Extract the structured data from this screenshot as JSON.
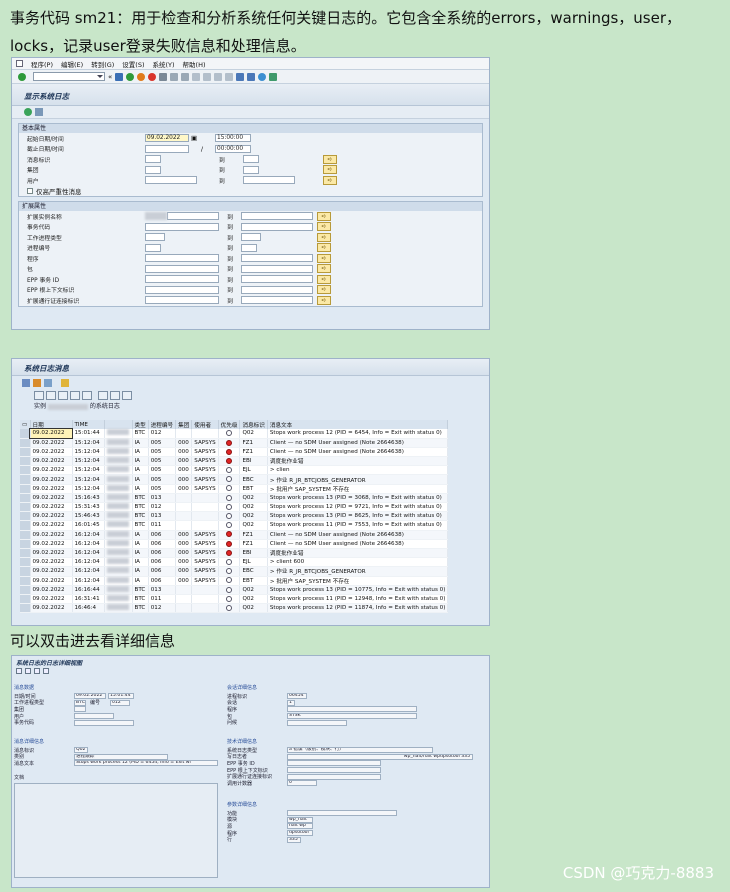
{
  "intro_text": "事务代码 sm21：用于检查和分析系统任何关键日志的。它包含全系统的errors，warnings，user，locks，记录user登录失败信息和处理信息。",
  "caption_text": "可以双击进去看详细信息",
  "watermark": "CSDN @巧克力-8883",
  "screen1": {
    "menu": [
      "程序(P)",
      "编辑(E)",
      "转到(G)",
      "设置(S)",
      "系统(Y)",
      "帮助(H)"
    ],
    "title": "显示系统日志",
    "group_basic": "基本属性",
    "group_extended": "扩展属性",
    "fields_basic": [
      {
        "label": "起始日期/时间",
        "value1": "09.02.2022",
        "value2": "15:00:00"
      },
      {
        "label": "截止日期/时间",
        "value1": "",
        "value2": "00:00:00"
      },
      {
        "label": "消息标识",
        "value1": "",
        "value2": ""
      },
      {
        "label": "集团",
        "value1": "",
        "value2": ""
      },
      {
        "label": "用户",
        "value1": "",
        "value2": ""
      }
    ],
    "only_severe": "仅高严重性消息",
    "to_label": "到",
    "fields_extended": [
      "扩展实例名称",
      "事务代码",
      "工作进程类型",
      "进程编号",
      "程序",
      "包",
      "EPP 事务 ID",
      "EPP 根上下文标识",
      "扩展通行证连接标识"
    ]
  },
  "screen2": {
    "title": "系统日志消息",
    "instance_label": "实例",
    "instance_suffix": "的系统日志",
    "columns": [
      "日期",
      "TIME",
      "",
      "类型",
      "进程编号",
      "集团",
      "使用者",
      "优先级",
      "消息标识",
      "消息文本"
    ],
    "rows": [
      {
        "date": "09.02.2022",
        "time": "15:01:44",
        "type": "BTC",
        "proc": "012",
        "client": "",
        "user": "",
        "prio": "empty",
        "id": "Q02",
        "text": "Stops work process 12 (PID = 6454, Info = Exit with status 0)"
      },
      {
        "date": "09.02.2022",
        "time": "15:12:04",
        "type": "IA",
        "proc": "005",
        "client": "000",
        "user": "SAPSYS",
        "prio": "red",
        "id": "FZ1",
        "text": "Client — no SDM User assigned (Note 2664638)"
      },
      {
        "date": "09.02.2022",
        "time": "15:12:04",
        "type": "IA",
        "proc": "005",
        "client": "000",
        "user": "SAPSYS",
        "prio": "red",
        "id": "FZ1",
        "text": "Client — no SDM User assigned (Note 2664638)"
      },
      {
        "date": "09.02.2022",
        "time": "15:12:04",
        "type": "IA",
        "proc": "005",
        "client": "000",
        "user": "SAPSYS",
        "prio": "red",
        "id": "EBI",
        "text": "调度批作业错"
      },
      {
        "date": "09.02.2022",
        "time": "15:12:04",
        "type": "IA",
        "proc": "005",
        "client": "000",
        "user": "SAPSYS",
        "prio": "empty",
        "id": "EJL",
        "text": "> clien"
      },
      {
        "date": "09.02.2022",
        "time": "15:12:04",
        "type": "IA",
        "proc": "005",
        "client": "000",
        "user": "SAPSYS",
        "prio": "empty",
        "id": "EBC",
        "text": "> 作业 R_JR_BTCJOBS_GENERATOR"
      },
      {
        "date": "09.02.2022",
        "time": "15:12:04",
        "type": "IA",
        "proc": "005",
        "client": "000",
        "user": "SAPSYS",
        "prio": "empty",
        "id": "EBT",
        "text": "> 批用户 SAP_SYSTEM 不存在"
      },
      {
        "date": "09.02.2022",
        "time": "15:16:43",
        "type": "BTC",
        "proc": "013",
        "client": "",
        "user": "",
        "prio": "empty",
        "id": "Q02",
        "text": "Stops work process 13 (PID = 3068, Info = Exit with status 0)"
      },
      {
        "date": "09.02.2022",
        "time": "15:31:43",
        "type": "BTC",
        "proc": "012",
        "client": "",
        "user": "",
        "prio": "empty",
        "id": "Q02",
        "text": "Stops work process 12 (PID = 9721, Info = Exit with status 0)"
      },
      {
        "date": "09.02.2022",
        "time": "15:46:43",
        "type": "BTC",
        "proc": "013",
        "client": "",
        "user": "",
        "prio": "empty",
        "id": "Q02",
        "text": "Stops work process 13 (PID = 8625, Info = Exit with status 0)"
      },
      {
        "date": "09.02.2022",
        "time": "16:01:45",
        "type": "BTC",
        "proc": "011",
        "client": "",
        "user": "",
        "prio": "empty",
        "id": "Q02",
        "text": "Stops work process 11 (PID = 7553, Info = Exit with status 0)"
      },
      {
        "date": "09.02.2022",
        "time": "16:12:04",
        "type": "IA",
        "proc": "006",
        "client": "000",
        "user": "SAPSYS",
        "prio": "red",
        "id": "FZ1",
        "text": "Client — no SDM User assigned (Note 2664638)"
      },
      {
        "date": "09.02.2022",
        "time": "16:12:04",
        "type": "IA",
        "proc": "006",
        "client": "000",
        "user": "SAPSYS",
        "prio": "red",
        "id": "FZ1",
        "text": "Client — no SDM User assigned (Note 2664638)"
      },
      {
        "date": "09.02.2022",
        "time": "16:12:04",
        "type": "IA",
        "proc": "006",
        "client": "000",
        "user": "SAPSYS",
        "prio": "red",
        "id": "EBI",
        "text": "调度批作业错"
      },
      {
        "date": "09.02.2022",
        "time": "16:12:04",
        "type": "IA",
        "proc": "006",
        "client": "000",
        "user": "SAPSYS",
        "prio": "empty",
        "id": "EJL",
        "text": "> client 600"
      },
      {
        "date": "09.02.2022",
        "time": "16:12:04",
        "type": "IA",
        "proc": "006",
        "client": "000",
        "user": "SAPSYS",
        "prio": "empty",
        "id": "EBC",
        "text": "> 作业 R_JR_BTCJOBS_GENERATOR"
      },
      {
        "date": "09.02.2022",
        "time": "16:12:04",
        "type": "IA",
        "proc": "006",
        "client": "000",
        "user": "SAPSYS",
        "prio": "empty",
        "id": "EBT",
        "text": "> 批用户 SAP_SYSTEM 不存在"
      },
      {
        "date": "09.02.2022",
        "time": "16:16:44",
        "type": "BTC",
        "proc": "013",
        "client": "",
        "user": "",
        "prio": "empty",
        "id": "Q02",
        "text": "Stops work process 13 (PID = 10775, Info = Exit with status 0)"
      },
      {
        "date": "09.02.2022",
        "time": "16:31:41",
        "type": "BTC",
        "proc": "011",
        "client": "",
        "user": "",
        "prio": "empty",
        "id": "Q02",
        "text": "Stops work process 11 (PID = 12948, Info = Exit with status 0)"
      },
      {
        "date": "09.02.2022",
        "time": "16:46:4",
        "type": "BTC",
        "proc": "012",
        "client": "",
        "user": "",
        "prio": "empty",
        "id": "Q02",
        "text": "Stops work process 12 (PID = 11874, Info = Exit with status 0)"
      }
    ]
  },
  "screen3": {
    "title": "系统日志的日志详细视图",
    "left_head": "消息数据",
    "left_rows": [
      {
        "label": "日期/时间",
        "value": "09.02.2022",
        "value2": "15:01:44"
      },
      {
        "label": "工作进程类型",
        "value": "BTC",
        "value2": "012"
      },
      {
        "label": "集团",
        "value": "",
        "value2": ""
      },
      {
        "label": "用户",
        "value": "",
        "value2": ""
      },
      {
        "label": "事务代码",
        "value": "",
        "value2": ""
      }
    ],
    "num_label": "编号",
    "msg_head": "消息详细信息",
    "msg_rows": [
      {
        "label": "消息标识",
        "value": "Q02"
      },
      {
        "label": "类别",
        "value": "进程跟踪"
      },
      {
        "label": "消息文本",
        "value": "Stops work process 12 (PID = 6454, Info = Exit wi"
      }
    ],
    "doc_label": "文档",
    "right_head1": "会话详细信息",
    "right_rows1": [
      {
        "label": "进程标识",
        "value": "06454"
      },
      {
        "label": "会话",
        "value": "1"
      },
      {
        "label": "程序",
        "value": ""
      },
      {
        "label": "包",
        "value": "STSK"
      },
      {
        "label": "问候",
        "value": ""
      }
    ],
    "right_head2": "技术详细信息",
    "right_rows2": [
      {
        "label": "系统日志类型",
        "value": "a 错误（级别、模块、行）"
      },
      {
        "label": "写日志者",
        "value": "wp_halt/halt wpdpsotool 335"
      },
      {
        "label": "EPP 事务 ID",
        "value": ""
      },
      {
        "label": "EPP 根上下文标识",
        "value": ""
      },
      {
        "label": "扩展通行证连接标识",
        "value": ""
      },
      {
        "label": "调用计数器",
        "value": "0"
      }
    ],
    "right_head3": "参数详细信息",
    "right_rows3": [
      {
        "label": "功能",
        "value": ""
      },
      {
        "label": "模块",
        "value": "wp_halt"
      },
      {
        "label": "源",
        "value": "halt wp"
      },
      {
        "label": "程序",
        "value": "dpsotool"
      },
      {
        "label": "行",
        "value": "335"
      }
    ]
  }
}
